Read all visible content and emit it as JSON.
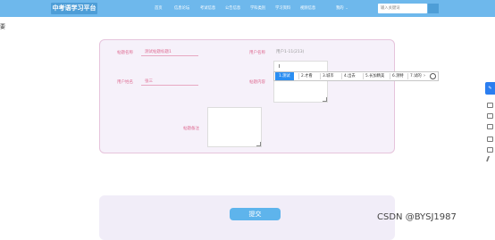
{
  "header": {
    "logo": "中考语学习平台",
    "nav": [
      "首页",
      "信息论坛",
      "考试信息",
      "公告信息",
      "学科类别",
      "学习资料",
      "视频信息"
    ],
    "user_menu": "我的",
    "user_caret": "⌄",
    "search_placeholder": "输入关键词"
  },
  "breadcrumb": "要",
  "form": {
    "labels": {
      "post_title": "帖题名称",
      "username": "用户名称",
      "user_name": "用户姓名",
      "post_content": "帖题内容",
      "remark": "帖题备注"
    },
    "values": {
      "post_title": "测试帖题标题1",
      "username": "用户1-11(213)",
      "user_name": "张三"
    },
    "content_caret": "I"
  },
  "ime": {
    "candidates": [
      "1.测试",
      "2.才看",
      "3.城市",
      "4.出去",
      "5.长加精美",
      "6.测特",
      "7.试的"
    ],
    "next_arrow": "›",
    "emoji": "☺"
  },
  "submit_label": "提交",
  "dock": {
    "active_icon": "✎"
  },
  "watermark": "CSDN @BYSJ1987",
  "colors": {
    "header_bg": "#6eb8ec",
    "accent": "#2b8ef2",
    "label_pink": "#de6b92",
    "card_bg": "#f6f1fa"
  }
}
